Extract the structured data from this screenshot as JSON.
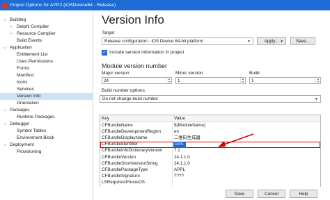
{
  "window": {
    "title": "Project Options for APP2  (iOSDevice64 - Release)"
  },
  "sidebar": {
    "items": [
      {
        "label": "Building",
        "indent": 0,
        "twisty": "⌵"
      },
      {
        "label": "Delphi Compiler",
        "indent": 1,
        "twisty": "›"
      },
      {
        "label": "Resource Compiler",
        "indent": 1,
        "twisty": "›"
      },
      {
        "label": "Build Events",
        "indent": 1,
        "twisty": ""
      },
      {
        "label": "Application",
        "indent": 0,
        "twisty": "⌵"
      },
      {
        "label": "Entitlement List",
        "indent": 1,
        "twisty": ""
      },
      {
        "label": "Uses Permissions",
        "indent": 1,
        "twisty": ""
      },
      {
        "label": "Forms",
        "indent": 1,
        "twisty": ""
      },
      {
        "label": "Manifest",
        "indent": 1,
        "twisty": ""
      },
      {
        "label": "Icons",
        "indent": 1,
        "twisty": ""
      },
      {
        "label": "Services",
        "indent": 1,
        "twisty": ""
      },
      {
        "label": "Version Info",
        "indent": 1,
        "twisty": "",
        "selected": true
      },
      {
        "label": "Orientation",
        "indent": 1,
        "twisty": ""
      },
      {
        "label": "Packages",
        "indent": 0,
        "twisty": "⌵"
      },
      {
        "label": "Runtime Packages",
        "indent": 1,
        "twisty": ""
      },
      {
        "label": "Debugger",
        "indent": 0,
        "twisty": "⌵"
      },
      {
        "label": "Symbol Tables",
        "indent": 1,
        "twisty": ""
      },
      {
        "label": "Environment Block",
        "indent": 1,
        "twisty": ""
      },
      {
        "label": "Deployment",
        "indent": 0,
        "twisty": "⌵"
      },
      {
        "label": "Provisioning",
        "indent": 1,
        "twisty": ""
      }
    ]
  },
  "main": {
    "heading": "Version Info",
    "target_label": "Target",
    "target_value": "Release configuration - iOS Device 64-bit platform",
    "apply_label": "Apply...",
    "save_label": "Save...",
    "include_label": "Include version information in project",
    "module_section": "Module version number",
    "major_label": "Major version",
    "major_value": "24",
    "minor_label": "Minor version",
    "minor_value": "1",
    "build_label": "Build",
    "build_value": "1",
    "build_options_label": "Build number options",
    "build_options_value": "Do not change build number",
    "table": {
      "headers": [
        "Key",
        "Value"
      ],
      "rows": [
        {
          "key": "CFBundleName",
          "value": "$(ModuleName)"
        },
        {
          "key": "CFBundleDevelopmentRegion",
          "value": "en"
        },
        {
          "key": "CFBundleDisplayName",
          "value": "二维码生成器"
        },
        {
          "key": "CFBundleIdentifier",
          "value": "com.",
          "highlight": true
        },
        {
          "key": "CFBundleInfoDictionaryVersion",
          "value": "7.1"
        },
        {
          "key": "CFBundleVersion",
          "value": "24.1.1.0"
        },
        {
          "key": "CFBundleShortVersionString",
          "value": "24.1.1.0"
        },
        {
          "key": "CFBundlePackageType",
          "value": "APPL"
        },
        {
          "key": "CFBundleSignature",
          "value": "????"
        },
        {
          "key": "LSRequiresIPhoneOS",
          "value": ""
        }
      ]
    },
    "save_button": "Save",
    "cancel_button": "Cancel",
    "help_button": "Help"
  },
  "colors": {
    "titlebar": "#1e6bd6",
    "selection": "#cfe3f7",
    "annotation": "#d00000"
  }
}
